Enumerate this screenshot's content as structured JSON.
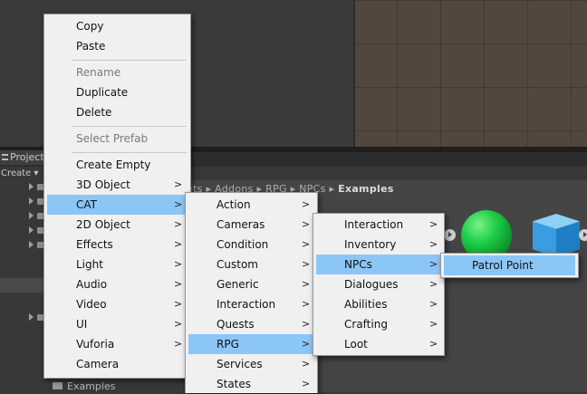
{
  "editor": {
    "project_tab": "Project",
    "create_button": "Create",
    "breadcrumb": [
      "ets",
      "Addons",
      "RPG",
      "NPCs"
    ],
    "breadcrumb_current": "Examples",
    "tree_examples": "Examples"
  },
  "menu1": {
    "items": [
      {
        "label": "Copy"
      },
      {
        "label": "Paste"
      },
      {
        "label": "Rename",
        "disabled": true
      },
      {
        "label": "Duplicate"
      },
      {
        "label": "Delete"
      },
      {
        "label": "Select Prefab",
        "disabled": true
      },
      {
        "label": "Create Empty"
      },
      {
        "label": "3D Object",
        "submenu": true
      },
      {
        "label": "CAT",
        "submenu": true,
        "selected": true
      },
      {
        "label": "2D Object",
        "submenu": true
      },
      {
        "label": "Effects",
        "submenu": true
      },
      {
        "label": "Light",
        "submenu": true
      },
      {
        "label": "Audio",
        "submenu": true
      },
      {
        "label": "Video",
        "submenu": true
      },
      {
        "label": "UI",
        "submenu": true
      },
      {
        "label": "Vuforia",
        "submenu": true
      },
      {
        "label": "Camera"
      }
    ]
  },
  "menu2": {
    "items": [
      {
        "label": "Action"
      },
      {
        "label": "Cameras"
      },
      {
        "label": "Condition"
      },
      {
        "label": "Custom"
      },
      {
        "label": "Generic"
      },
      {
        "label": "Interaction"
      },
      {
        "label": "Quests"
      },
      {
        "label": "RPG",
        "selected": true
      },
      {
        "label": "Services"
      },
      {
        "label": "States"
      }
    ]
  },
  "menu3": {
    "items": [
      {
        "label": "Interaction"
      },
      {
        "label": "Inventory"
      },
      {
        "label": "NPCs",
        "selected": true
      },
      {
        "label": "Dialogues"
      },
      {
        "label": "Abilities"
      },
      {
        "label": "Crafting"
      },
      {
        "label": "Loot"
      }
    ]
  },
  "menu4": {
    "items": [
      {
        "label": "Patrol Point",
        "selected": true
      }
    ]
  },
  "colors": {
    "menu_bg": "#f0f0f0",
    "selection": "#8cc6f7",
    "editor_dark": "#383838"
  }
}
